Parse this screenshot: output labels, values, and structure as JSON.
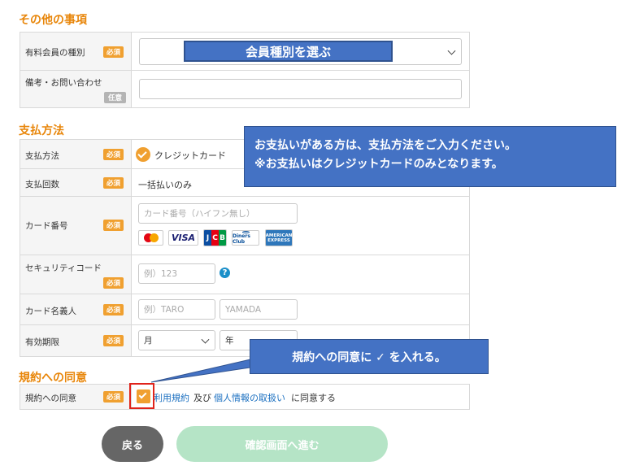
{
  "sections": {
    "other": "その他の事項",
    "payment": "支払方法",
    "agreement": "規約への同意"
  },
  "badges": {
    "required": "必須",
    "optional": "任意"
  },
  "other": {
    "membership_label": "有料会員の種別",
    "membership_select_overlay": "会員種別を選ぶ",
    "remarks_label": "備考・お問い合わせ",
    "remarks_value": ""
  },
  "payment": {
    "method_label": "支払方法",
    "method_value": "クレジットカード",
    "installments_label": "支払回数",
    "installments_value": "一括払いのみ",
    "card_number_label": "カード番号",
    "card_number_placeholder": "カード番号（ハイフン無し）",
    "security_label": "セキュリティコード",
    "security_placeholder": "例）123",
    "holder_label": "カード名義人",
    "holder_first_placeholder": "例）TARO",
    "holder_last_placeholder": "YAMADA",
    "expiry_label": "有効期限",
    "expiry_month": "月",
    "expiry_year": "年"
  },
  "card_brands": [
    "MasterCard",
    "VISA",
    "JCB",
    "Diners Club",
    "AMERICAN EXPRESS"
  ],
  "agreement": {
    "label": "規約への同意",
    "checked": true,
    "terms_link": "利用規約",
    "and": "及び",
    "privacy_link": "個人情報の取扱い",
    "suffix": "に同意する"
  },
  "callouts": {
    "payment_line1": "お支払いがある方は、支払方法をご入力ください。",
    "payment_line2": "※お支払いはクレジットカードのみとなります。",
    "agreement": "規約への同意に ✓ を入れる。"
  },
  "buttons": {
    "back": "戻る",
    "confirm": "確認画面へ進む"
  },
  "colors": {
    "accent_orange": "#e8860a",
    "required_badge": "#f0a030",
    "link_blue": "#1a6fc0",
    "callout_blue": "#4472c4",
    "back_button": "#666666",
    "confirm_button": "#b5e4c6",
    "highlight_red": "#e0241b"
  }
}
